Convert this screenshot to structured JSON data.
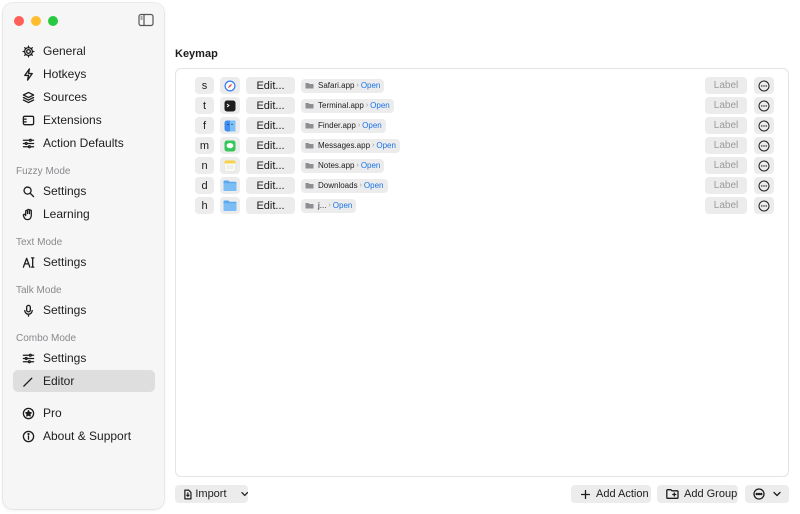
{
  "sidebar": {
    "items": [
      {
        "label": "General",
        "icon": "gear-icon"
      },
      {
        "label": "Hotkeys",
        "icon": "bolt-icon"
      },
      {
        "label": "Sources",
        "icon": "stack-icon"
      },
      {
        "label": "Extensions",
        "icon": "extension-icon"
      },
      {
        "label": "Action Defaults",
        "icon": "sliders-icon"
      }
    ],
    "fuzzy_mode": {
      "title": "Fuzzy Mode",
      "items": [
        {
          "label": "Settings",
          "icon": "search-icon"
        },
        {
          "label": "Learning",
          "icon": "hand-icon"
        }
      ]
    },
    "text_mode": {
      "title": "Text Mode",
      "items": [
        {
          "label": "Settings",
          "icon": "text-cursor-icon"
        }
      ]
    },
    "talk_mode": {
      "title": "Talk Mode",
      "items": [
        {
          "label": "Settings",
          "icon": "microphone-icon"
        }
      ]
    },
    "combo_mode": {
      "title": "Combo Mode",
      "items": [
        {
          "label": "Settings",
          "icon": "sliders-icon"
        },
        {
          "label": "Editor",
          "icon": "pencil-icon",
          "active": true
        }
      ]
    },
    "footer_items": [
      {
        "label": "Pro",
        "icon": "star-badge-icon"
      },
      {
        "label": "About & Support",
        "icon": "info-icon"
      }
    ]
  },
  "main": {
    "title": "Keymap",
    "rows": [
      {
        "key": "s",
        "icon": "safari-app-icon",
        "icon_color": "#2f7cf6",
        "edit": "Edit...",
        "path": "Safari.app",
        "open": "Open",
        "label": "Label"
      },
      {
        "key": "t",
        "icon": "terminal-app-icon",
        "icon_color": "#1e1e1e",
        "edit": "Edit...",
        "path": "Terminal.app",
        "open": "Open",
        "label": "Label"
      },
      {
        "key": "f",
        "icon": "finder-app-icon",
        "icon_color": "#3e8df0",
        "edit": "Edit...",
        "path": "Finder.app",
        "open": "Open",
        "label": "Label"
      },
      {
        "key": "m",
        "icon": "messages-app-icon",
        "icon_color": "#34c759",
        "edit": "Edit...",
        "path": "Messages.app",
        "open": "Open",
        "label": "Label"
      },
      {
        "key": "n",
        "icon": "notes-app-icon",
        "icon_color": "#f7d34a",
        "edit": "Edit...",
        "path": "Notes.app",
        "open": "Open",
        "label": "Label"
      },
      {
        "key": "d",
        "icon": "folder-icon",
        "icon_color": "#5aa9f0",
        "edit": "Edit...",
        "path": "Downloads",
        "open": "Open",
        "label": "Label"
      },
      {
        "key": "h",
        "icon": "folder-icon",
        "icon_color": "#5aa9f0",
        "edit": "Edit...",
        "path": "j...",
        "open": "Open",
        "label": "Label"
      }
    ],
    "path_separator": "›"
  },
  "bottom": {
    "import": "Import",
    "add_action": "Add Action",
    "add_group": "Add Group"
  },
  "colors": {
    "accent": "#1a73e8",
    "sidebar_bg": "#f6f6f6",
    "active_item_bg": "#dedede"
  }
}
